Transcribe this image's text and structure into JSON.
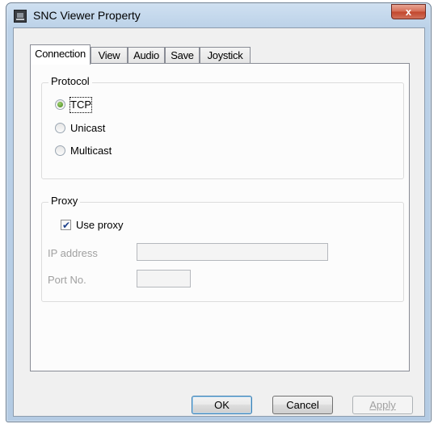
{
  "window": {
    "title": "SNC Viewer Property",
    "close_symbol": "x"
  },
  "tabs": [
    {
      "label": "Connection",
      "active": true
    },
    {
      "label": "View"
    },
    {
      "label": "Audio"
    },
    {
      "label": "Save"
    },
    {
      "label": "Joystick"
    }
  ],
  "protocol": {
    "group_label": "Protocol",
    "options": [
      {
        "label": "TCP",
        "selected": true
      },
      {
        "label": "Unicast",
        "selected": false
      },
      {
        "label": "Multicast",
        "selected": false
      }
    ]
  },
  "proxy": {
    "group_label": "Proxy",
    "use_proxy_label": "Use proxy",
    "use_proxy_checked": true,
    "ip_label": "IP address",
    "ip_value": "",
    "port_label": "Port No.",
    "port_value": ""
  },
  "buttons": {
    "ok": "OK",
    "cancel": "Cancel",
    "apply": "Apply"
  }
}
